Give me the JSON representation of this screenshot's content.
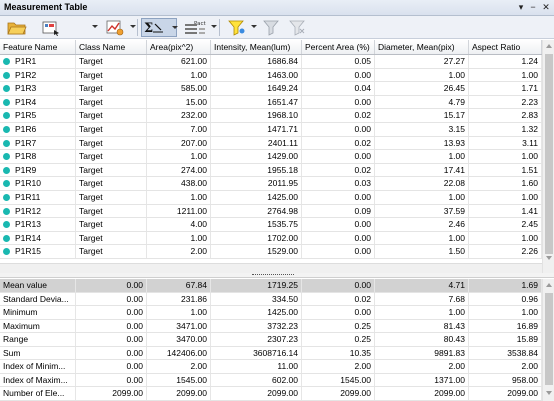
{
  "window": {
    "title": "Measurement Table"
  },
  "toolbar": {
    "icons": [
      "open-folder-icon",
      "add-selection-icon",
      "chart-settings-icon",
      "statistics-sum-icon",
      "data-list-icon",
      "filter-highlight-icon",
      "filter-icon",
      "filter-clear-icon"
    ]
  },
  "columns": [
    "Feature Name",
    "Class Name",
    "Area(pix^2)",
    "Intensity, Mean(lum)",
    "Percent Area (%)",
    "Diameter, Mean(pix)",
    "Aspect Ratio"
  ],
  "rows": [
    [
      "P1R1",
      "Target",
      "621.00",
      "1686.84",
      "0.05",
      "27.27",
      "1.24"
    ],
    [
      "P1R2",
      "Target",
      "1.00",
      "1463.00",
      "0.00",
      "1.00",
      "1.00"
    ],
    [
      "P1R3",
      "Target",
      "585.00",
      "1649.24",
      "0.04",
      "26.45",
      "1.71"
    ],
    [
      "P1R4",
      "Target",
      "15.00",
      "1651.47",
      "0.00",
      "4.79",
      "2.23"
    ],
    [
      "P1R5",
      "Target",
      "232.00",
      "1968.10",
      "0.02",
      "15.17",
      "2.83"
    ],
    [
      "P1R6",
      "Target",
      "7.00",
      "1471.71",
      "0.00",
      "3.15",
      "1.32"
    ],
    [
      "P1R7",
      "Target",
      "207.00",
      "2401.11",
      "0.02",
      "13.93",
      "3.11"
    ],
    [
      "P1R8",
      "Target",
      "1.00",
      "1429.00",
      "0.00",
      "1.00",
      "1.00"
    ],
    [
      "P1R9",
      "Target",
      "274.00",
      "1955.18",
      "0.02",
      "17.41",
      "1.51"
    ],
    [
      "P1R10",
      "Target",
      "438.00",
      "2011.95",
      "0.03",
      "22.08",
      "1.60"
    ],
    [
      "P1R11",
      "Target",
      "1.00",
      "1425.00",
      "0.00",
      "1.00",
      "1.00"
    ],
    [
      "P1R12",
      "Target",
      "1211.00",
      "2764.98",
      "0.09",
      "37.59",
      "1.41"
    ],
    [
      "P1R13",
      "Target",
      "4.00",
      "1535.75",
      "0.00",
      "2.46",
      "2.45"
    ],
    [
      "P1R14",
      "Target",
      "1.00",
      "1702.00",
      "0.00",
      "1.00",
      "1.00"
    ],
    [
      "P1R15",
      "Target",
      "2.00",
      "1529.00",
      "0.00",
      "1.50",
      "2.26"
    ]
  ],
  "stats": [
    [
      "Mean value",
      "0.00",
      "67.84",
      "1719.25",
      "0.00",
      "4.71",
      "1.69"
    ],
    [
      "Standard Devia...",
      "0.00",
      "231.86",
      "334.50",
      "0.02",
      "7.68",
      "0.96"
    ],
    [
      "Minimum",
      "0.00",
      "1.00",
      "1425.00",
      "0.00",
      "1.00",
      "1.00"
    ],
    [
      "Maximum",
      "0.00",
      "3471.00",
      "3732.23",
      "0.25",
      "81.43",
      "16.89"
    ],
    [
      "Range",
      "0.00",
      "3470.00",
      "2307.23",
      "0.25",
      "80.43",
      "15.89"
    ],
    [
      "Sum",
      "0.00",
      "142406.00",
      "3608716.14",
      "10.35",
      "9891.83",
      "3538.84"
    ],
    [
      "Index of Minim...",
      "0.00",
      "2.00",
      "11.00",
      "2.00",
      "2.00",
      "2.00"
    ],
    [
      "Index of Maxim...",
      "0.00",
      "1545.00",
      "602.00",
      "1545.00",
      "1371.00",
      "958.00"
    ],
    [
      "Number of Ele...",
      "2099.00",
      "2099.00",
      "2099.00",
      "2099.00",
      "2099.00",
      "2099.00"
    ]
  ],
  "colors": {
    "status_dot": "#19b8b0",
    "selected_row": "#d2d2d2"
  }
}
